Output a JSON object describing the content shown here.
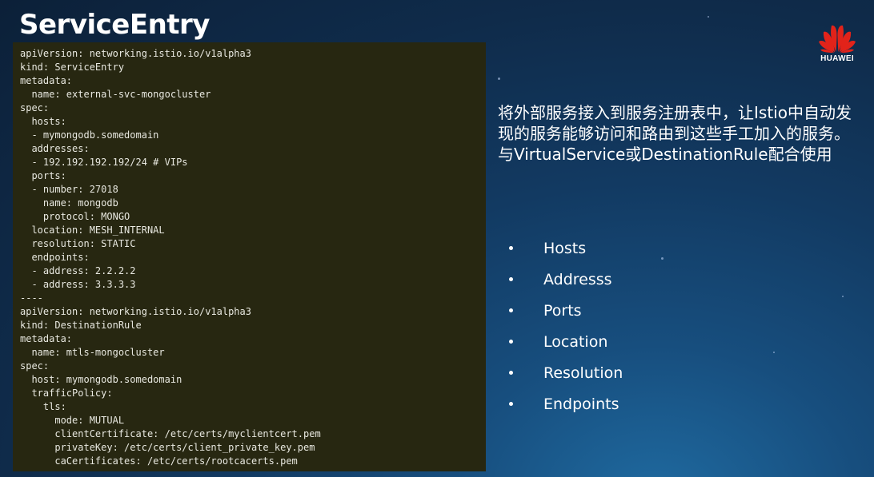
{
  "slide": {
    "title": "ServiceEntry"
  },
  "logo": {
    "icon": "huawei-petal-logo",
    "text": "HUAWEI",
    "color": "#e2231a"
  },
  "code": {
    "lines": [
      "apiVersion: networking.istio.io/v1alpha3",
      "kind: ServiceEntry",
      "metadata:",
      "  name: external-svc-mongocluster",
      "spec:",
      "  hosts:",
      "  - mymongodb.somedomain",
      "  addresses:",
      "  - 192.192.192.192/24 # VIPs",
      "  ports:",
      "  - number: 27018",
      "    name: mongodb",
      "    protocol: MONGO",
      "  location: MESH_INTERNAL",
      "  resolution: STATIC",
      "  endpoints:",
      "  - address: 2.2.2.2",
      "  - address: 3.3.3.3",
      "----",
      "apiVersion: networking.istio.io/v1alpha3",
      "kind: DestinationRule",
      "metadata:",
      "  name: mtls-mongocluster",
      "spec:",
      "  host: mymongodb.somedomain",
      "  trafficPolicy:",
      "    tls:",
      "      mode: MUTUAL",
      "      clientCertificate: /etc/certs/myclientcert.pem",
      "      privateKey: /etc/certs/client_private_key.pem",
      "      caCertificates: /etc/certs/rootcacerts.pem"
    ]
  },
  "description": "将外部服务接入到服务注册表中，让Istio中自动发现的服务能够访问和路由到这些手工加入的服务。与VirtualService或DestinationRule配合使用",
  "features": [
    {
      "label": "Hosts"
    },
    {
      "label": "Addresss"
    },
    {
      "label": "Ports"
    },
    {
      "label": "Location"
    },
    {
      "label": "Resolution"
    },
    {
      "label": "Endpoints"
    }
  ],
  "colors": {
    "code_background": "#272711",
    "slide_background": "#123a62",
    "text": "#ffffff"
  }
}
